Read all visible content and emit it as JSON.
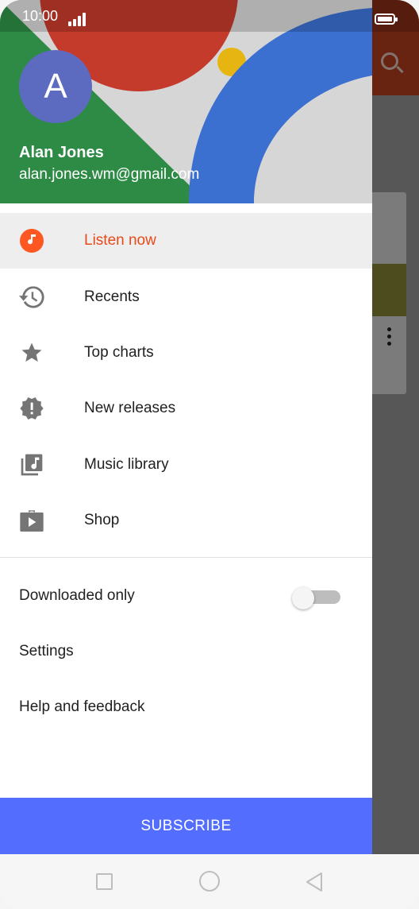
{
  "status_bar": {
    "time": "10:00"
  },
  "account": {
    "avatar_letter": "A",
    "name": "Alan Jones",
    "email": "alan.jones.wm@gmail.com"
  },
  "menu": {
    "items": [
      {
        "label": "Listen now",
        "icon": "music-note-icon",
        "active": true
      },
      {
        "label": "Recents",
        "icon": "history-icon",
        "active": false
      },
      {
        "label": "Top charts",
        "icon": "star-icon",
        "active": false
      },
      {
        "label": "New releases",
        "icon": "new-releases-icon",
        "active": false
      },
      {
        "label": "Music library",
        "icon": "library-music-icon",
        "active": false
      },
      {
        "label": "Shop",
        "icon": "shop-icon",
        "active": false
      }
    ]
  },
  "secondary": {
    "downloaded_only": {
      "label": "Downloaded only",
      "enabled": false
    },
    "settings_label": "Settings",
    "help_label": "Help and feedback"
  },
  "subscribe_label": "SUBSCRIBE",
  "colors": {
    "accent": "#e64a19",
    "subscribe": "#536dfe",
    "avatar": "#5c6bc0",
    "icon_gray": "#757575"
  }
}
